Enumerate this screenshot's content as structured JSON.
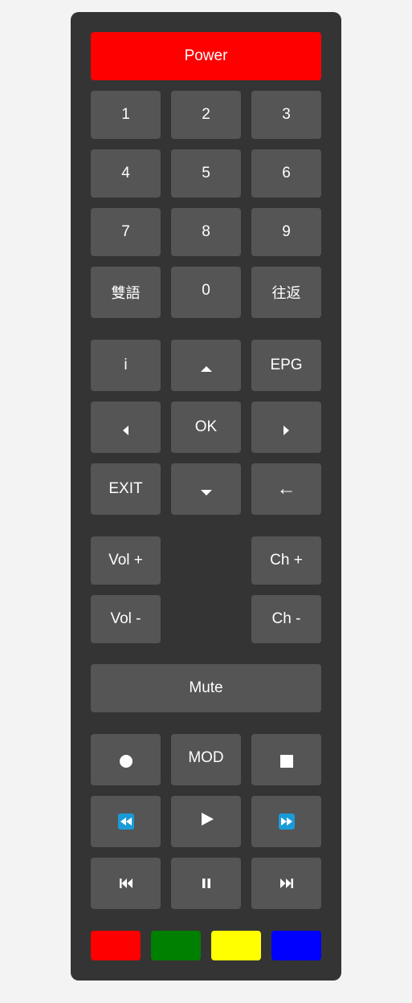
{
  "power": {
    "label": "Power",
    "color": "#ff0000"
  },
  "numpad": {
    "keys": [
      "1",
      "2",
      "3",
      "4",
      "5",
      "6",
      "7",
      "8",
      "9"
    ],
    "bilingual": "雙語",
    "zero": "0",
    "recall": "往返"
  },
  "navigation": {
    "info": "i",
    "epg": "EPG",
    "ok": "OK",
    "exit": "EXIT",
    "back": "←",
    "up_icon": "triangle-up-icon",
    "down_icon": "triangle-down-icon",
    "left_icon": "triangle-left-icon",
    "right_icon": "triangle-right-icon"
  },
  "volume": {
    "up": "Vol +",
    "down": "Vol -"
  },
  "channel": {
    "up": "Ch +",
    "down": "Ch -"
  },
  "mute": {
    "label": "Mute"
  },
  "media": {
    "record_icon": "record-icon",
    "mod": "MOD",
    "stop_icon": "stop-icon",
    "rewind_icon": "rewind-icon",
    "play_icon": "play-icon",
    "fast_forward_icon": "fast-forward-icon",
    "skip_back_icon": "skip-back-icon",
    "pause_icon": "pause-icon",
    "skip_forward_icon": "skip-forward-icon"
  },
  "color_keys": [
    {
      "name": "red",
      "color": "#ff0000"
    },
    {
      "name": "green",
      "color": "#008000"
    },
    {
      "name": "yellow",
      "color": "#ffff00"
    },
    {
      "name": "blue",
      "color": "#0000ff"
    }
  ],
  "theme": {
    "page_background": "#f3f3f3",
    "remote_background": "#343434",
    "button_background": "#555555",
    "text_color": "#ffffff",
    "media_key_accent": "#1a9bd7"
  }
}
